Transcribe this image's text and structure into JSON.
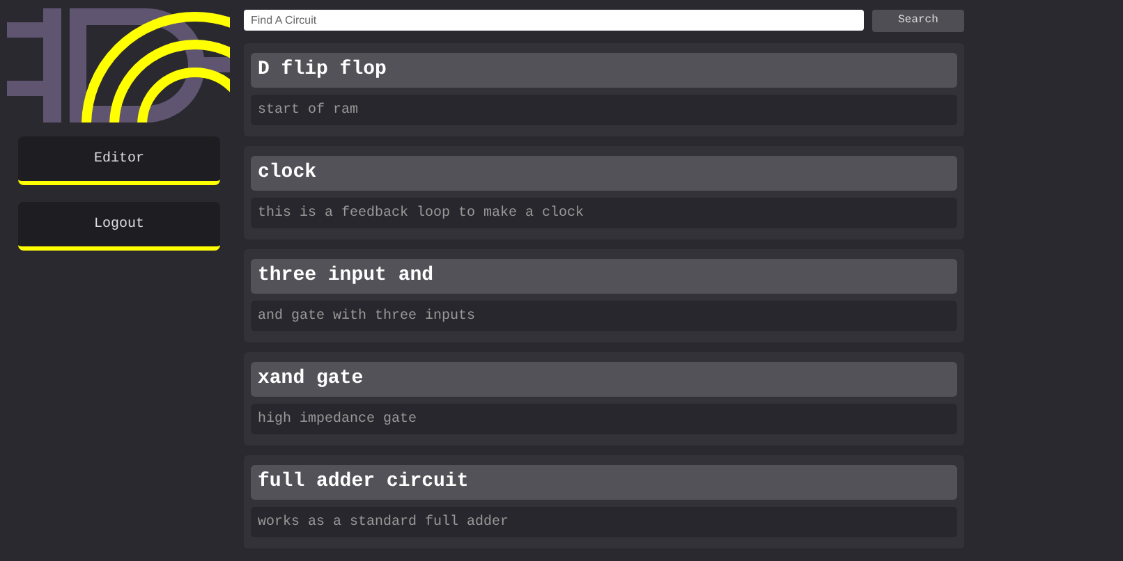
{
  "sidebar": {
    "buttons": [
      {
        "label": "Editor"
      },
      {
        "label": "Logout"
      }
    ]
  },
  "search": {
    "placeholder": "Find A Circuit",
    "button": "Search"
  },
  "circuits": [
    {
      "title": "D flip flop",
      "description": "start of ram"
    },
    {
      "title": "clock",
      "description": "this is a feedback loop to make a clock"
    },
    {
      "title": "three input and",
      "description": "and gate with three inputs"
    },
    {
      "title": "xand gate",
      "description": "high impedance gate"
    },
    {
      "title": "full adder circuit",
      "description": "works as a standard full adder"
    }
  ]
}
